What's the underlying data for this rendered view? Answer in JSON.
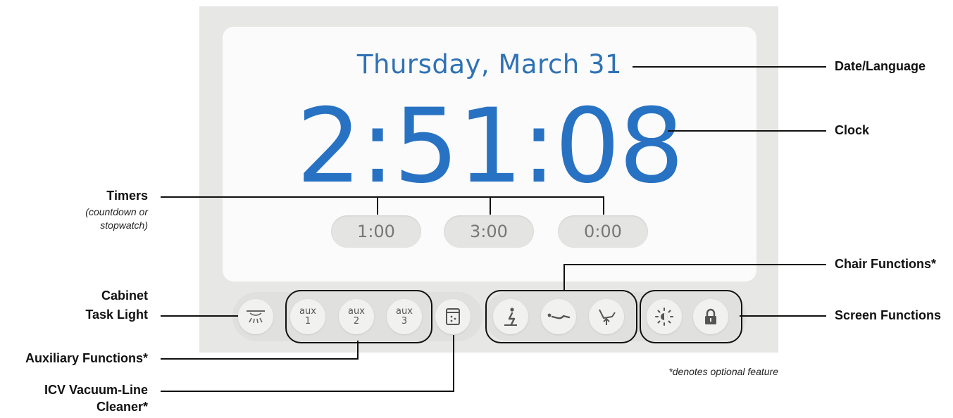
{
  "screen": {
    "date": "Thursday, March 31",
    "clock": "2:51:08",
    "timers": [
      "1:00",
      "3:00",
      "0:00"
    ]
  },
  "buttons": {
    "aux": [
      {
        "top": "aux",
        "bottom": "1"
      },
      {
        "top": "aux",
        "bottom": "2"
      },
      {
        "top": "aux",
        "bottom": "3"
      }
    ]
  },
  "icons": {
    "task_light": "cabinet-light-icon",
    "icv": "vacuum-line-cleaner-icon",
    "chair": [
      "chair-entry-icon",
      "chair-recline-icon",
      "chair-raise-icon"
    ],
    "screen": [
      "brightness-icon",
      "lock-icon"
    ]
  },
  "callouts": {
    "date_language": "Date/Language",
    "clock": "Clock",
    "timers": "Timers",
    "timers_sub": [
      "(countdown or",
      "stopwatch)"
    ],
    "chair_functions": "Chair Functions*",
    "cabinet_line1": "Cabinet",
    "cabinet_line2": "Task Light",
    "screen_functions": "Screen Functions",
    "auxiliary_functions": "Auxiliary Functions*",
    "icv_line1": "ICV Vacuum-Line",
    "icv_line2": "Cleaner*",
    "footnote": "*denotes optional feature"
  },
  "colors": {
    "clock_blue": "#2872c3",
    "date_blue": "#2f72b5",
    "panel_gray": "#e7e7e6"
  }
}
